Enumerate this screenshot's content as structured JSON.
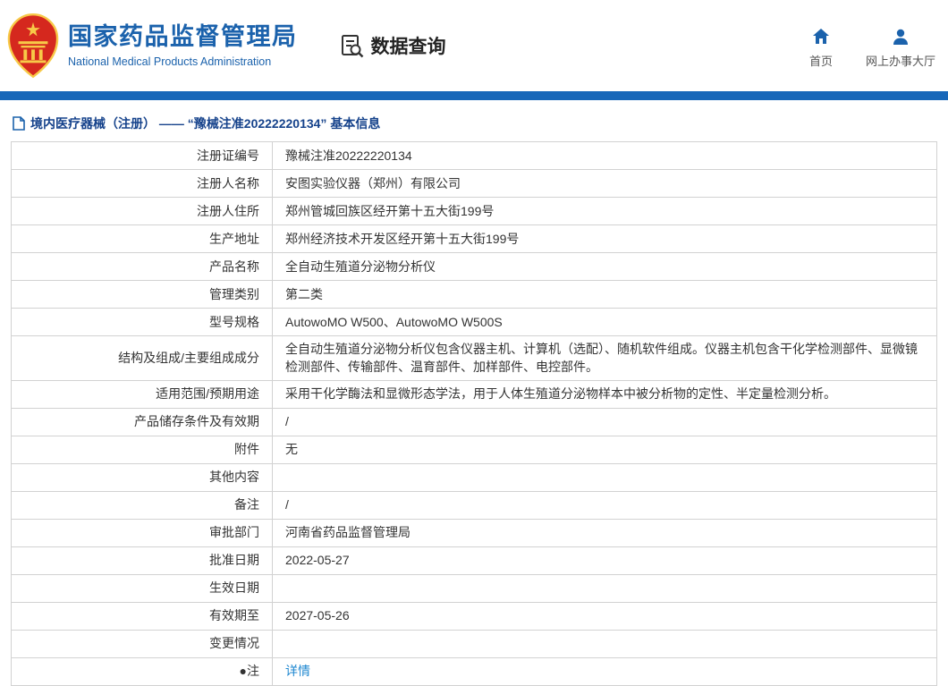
{
  "header": {
    "title_cn": "国家药品监督管理局",
    "title_en": "National Medical Products Administration",
    "data_query_label": "数据查询",
    "nav": [
      {
        "label": "首页",
        "icon": "home-icon"
      },
      {
        "label": "网上办事大厅",
        "icon": "user-icon"
      }
    ],
    "accent_color": "#1b62ac",
    "bar_color": "#1767b9",
    "emblem_colors": {
      "red": "#d5281e",
      "gold": "#f7c948"
    }
  },
  "breadcrumb": {
    "text": "境内医疗器械（注册） —— “豫械注准20222220134” 基本信息"
  },
  "table": {
    "rows": [
      {
        "label": "注册证编号",
        "value": "豫械注准20222220134"
      },
      {
        "label": "注册人名称",
        "value": "安图实验仪器（郑州）有限公司"
      },
      {
        "label": "注册人住所",
        "value": "郑州管城回族区经开第十五大街199号"
      },
      {
        "label": "生产地址",
        "value": "郑州经济技术开发区经开第十五大街199号"
      },
      {
        "label": "产品名称",
        "value": "全自动生殖道分泌物分析仪"
      },
      {
        "label": "管理类别",
        "value": "第二类"
      },
      {
        "label": "型号规格",
        "value": "AutowoMO W500、AutowoMO W500S"
      },
      {
        "label": "结构及组成/主要组成成分",
        "value": "全自动生殖道分泌物分析仪包含仪器主机、计算机（选配）、随机软件组成。仪器主机包含干化学检测部件、显微镜检测部件、传输部件、温育部件、加样部件、电控部件。"
      },
      {
        "label": "适用范围/预期用途",
        "value": "采用干化学酶法和显微形态学法，用于人体生殖道分泌物样本中被分析物的定性、半定量检测分析。"
      },
      {
        "label": "产品储存条件及有效期",
        "value": "/"
      },
      {
        "label": "附件",
        "value": "无"
      },
      {
        "label": "其他内容",
        "value": ""
      },
      {
        "label": "备注",
        "value": "/"
      },
      {
        "label": "审批部门",
        "value": "河南省药品监督管理局"
      },
      {
        "label": "批准日期",
        "value": "2022-05-27"
      },
      {
        "label": "生效日期",
        "value": ""
      },
      {
        "label": "有效期至",
        "value": "2027-05-26"
      },
      {
        "label": "变更情况",
        "value": ""
      },
      {
        "label": "●注",
        "value": "详情",
        "link": true
      }
    ]
  }
}
